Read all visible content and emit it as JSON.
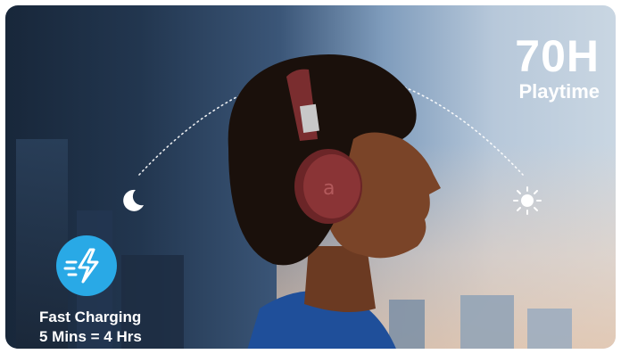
{
  "playtime": {
    "value": "70H",
    "label": "Playtime"
  },
  "charging": {
    "title": "Fast Charging",
    "detail": "5 Mins = 4 Hrs"
  },
  "icons": {
    "night": "moon-icon",
    "day": "sun-icon",
    "charge": "lightning-bolt-icon"
  },
  "colors": {
    "accent": "#29a9e6",
    "headphone": "#7a2d2f"
  }
}
